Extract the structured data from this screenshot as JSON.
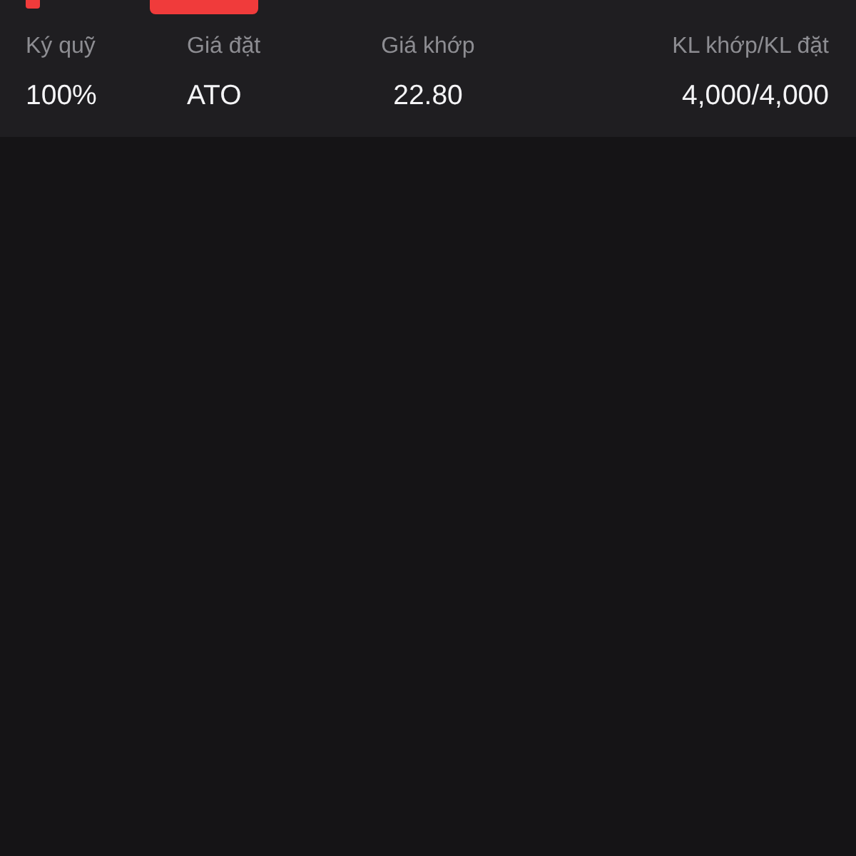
{
  "order_details": {
    "fields": [
      {
        "label": "Ký quỹ",
        "value": "100%"
      },
      {
        "label": "Giá đặt",
        "value": "ATO"
      },
      {
        "label": "Giá khớp",
        "value": "22.80"
      },
      {
        "label": "KL khớp/KL đặt",
        "value": "4,000/4,000"
      }
    ]
  }
}
